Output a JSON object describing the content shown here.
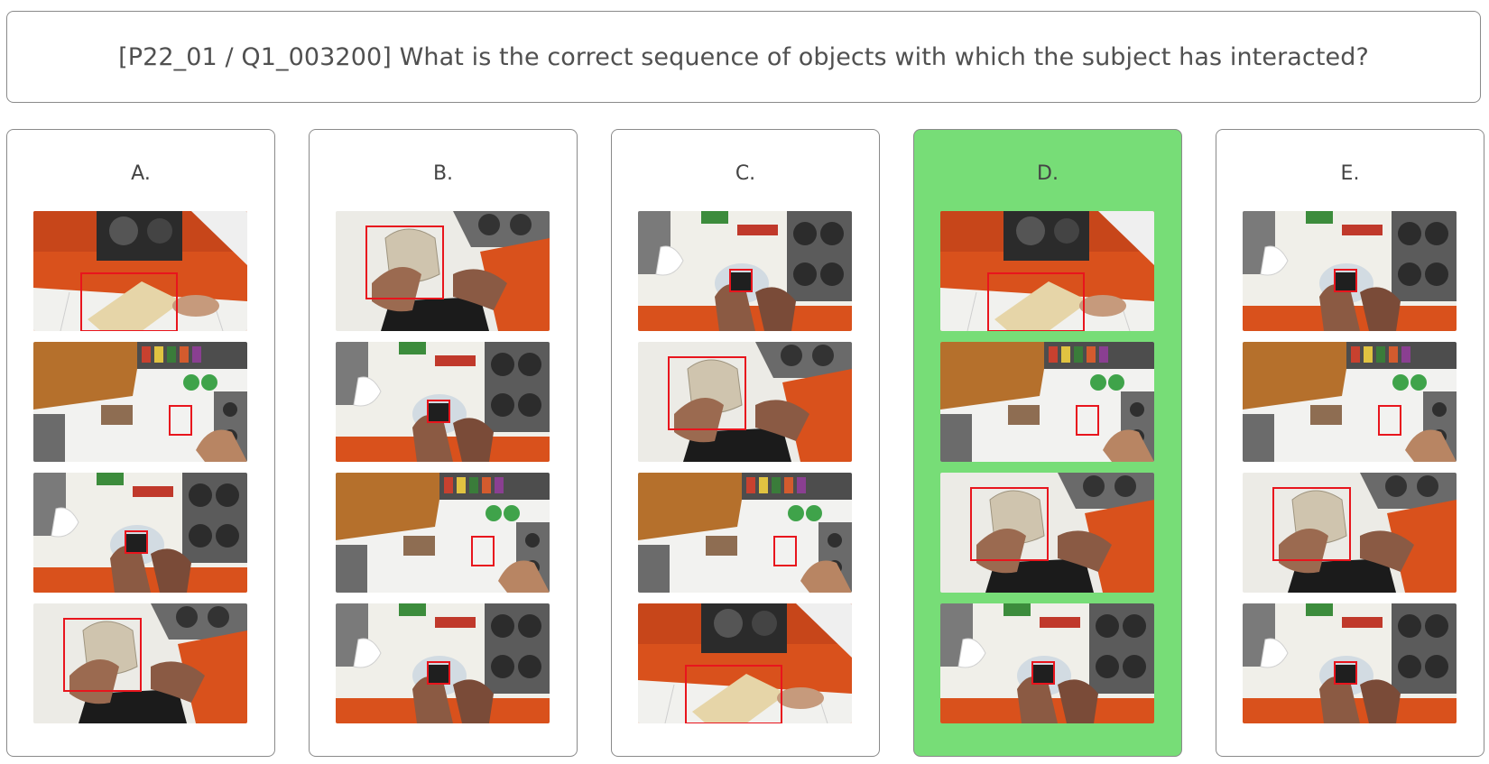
{
  "question": {
    "text": "[P22_01 / Q1_003200] What is the correct sequence of objects with which the subject has interacted?"
  },
  "options": [
    {
      "label": "A.",
      "selected": false,
      "frames": [
        "cutting-board-frame",
        "pouch-frame",
        "dark-cup-frame",
        "bag-frame"
      ]
    },
    {
      "label": "B.",
      "selected": false,
      "frames": [
        "bag-frame",
        "dark-cup-frame",
        "pouch-frame",
        "dark-cup-frame"
      ]
    },
    {
      "label": "C.",
      "selected": false,
      "frames": [
        "dark-cup-frame",
        "bag-frame",
        "pouch-frame",
        "cutting-board-frame"
      ]
    },
    {
      "label": "D.",
      "selected": true,
      "frames": [
        "cutting-board-frame",
        "pouch-frame",
        "bag-frame",
        "dark-cup-frame"
      ]
    },
    {
      "label": "E.",
      "selected": false,
      "frames": [
        "dark-cup-frame",
        "pouch-frame",
        "bag-frame",
        "dark-cup-frame"
      ]
    }
  ],
  "colors": {
    "selected_background": "#77dd77",
    "card_border": "#8a8a8a",
    "bbox": "#e8151d",
    "floor_tile": "#e2531c"
  }
}
